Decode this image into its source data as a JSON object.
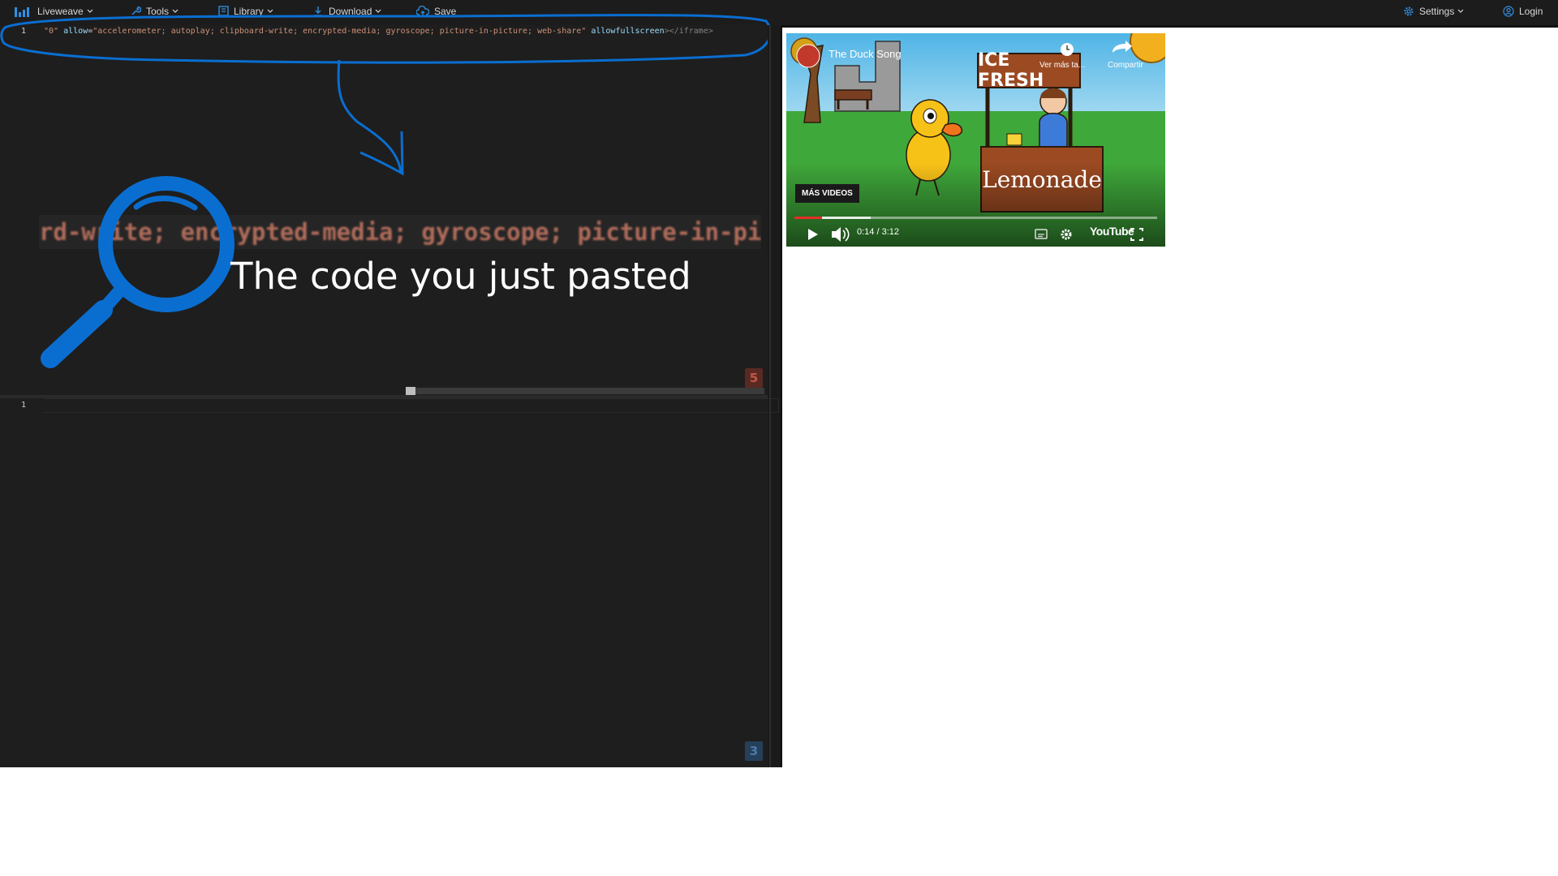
{
  "nav": {
    "brand": "Liveweave",
    "tools": "Tools",
    "library": "Library",
    "download": "Download",
    "save": "Save",
    "settings": "Settings",
    "login": "Login",
    "accent_color": "#2f8fe3"
  },
  "html_editor": {
    "line_number": "1",
    "code": {
      "t1": "\"0\" ",
      "t2": "allow",
      "t3": "=",
      "t4": "\"accelerometer; autoplay; clipboard-write; encrypted-media; gyroscope; picture-in-picture; web-share\"",
      "t5": " allowfullscreen",
      "t6": "></iframe>"
    },
    "badge": "5"
  },
  "annotation": {
    "zoom_text": "rd-write; encrypted-media; gyroscope; picture-in-pi",
    "caption": "The code you just pasted",
    "icon": "magnifying-glass-icon",
    "color": "#0a6ed1"
  },
  "css_editor": {
    "line_number": "1",
    "badge": "3"
  },
  "video": {
    "title": "The Duck Song",
    "watch_later": "Ver más ta...",
    "share": "Compartir",
    "more_videos": "MÁS VIDEOS",
    "time": "0:14 / 3:12",
    "platform": "YouTube",
    "sign_top": "ICE FRESH",
    "sign_bottom": "Lemonade"
  }
}
